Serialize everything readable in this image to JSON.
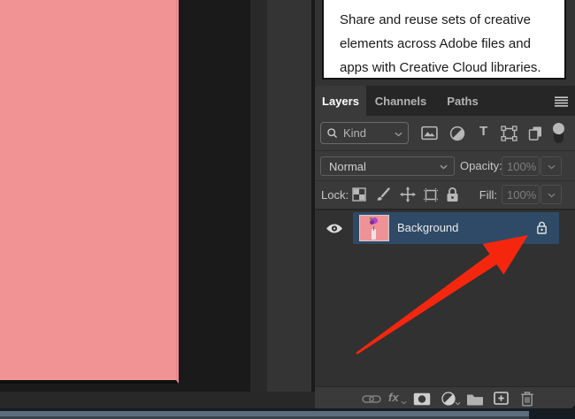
{
  "tooltip": {
    "text": "Share and reuse sets of creative elements across Adobe files and apps with Creative Cloud libraries."
  },
  "panel": {
    "tabs": [
      {
        "label": "Layers",
        "active": true
      },
      {
        "label": "Channels",
        "active": false
      },
      {
        "label": "Paths",
        "active": false
      }
    ],
    "filter": {
      "kind_label": "Kind",
      "type_glyph": "T",
      "icons": [
        "pixel-layer-filter",
        "adjustment-layer-filter",
        "type-layer-filter",
        "shape-layer-filter",
        "smart-object-filter",
        "filter-toggle"
      ]
    },
    "blend": {
      "mode": "Normal",
      "opacity_label": "Opacity:",
      "opacity_value": "100%"
    },
    "lock": {
      "label": "Lock:",
      "icons": [
        "lock-transparency",
        "lock-pixels",
        "lock-position",
        "lock-artboard",
        "lock-all"
      ],
      "fill_label": "Fill:",
      "fill_value": "100%"
    },
    "layers": [
      {
        "name": "Background",
        "visible": true,
        "locked": true,
        "selected": true
      }
    ],
    "toolbar": {
      "fx_label": "fx",
      "icons": [
        "link-layers",
        "layer-styles",
        "add-layer-mask",
        "new-adjustment-layer",
        "new-group",
        "new-layer",
        "delete-layer"
      ]
    }
  },
  "colors": {
    "canvas_pink": "#f19394",
    "selection_blue": "#2e4a66",
    "annotation_red": "#f4270e",
    "panel_bg": "#3a3a3a"
  }
}
